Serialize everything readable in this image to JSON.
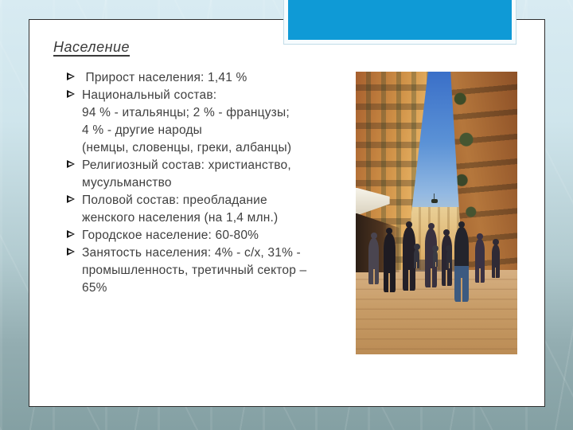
{
  "slide": {
    "title": "Население",
    "body": {
      "lines": [
        {
          "bullet": true,
          "text": " Прирост населения: 1,41 %"
        },
        {
          "bullet": true,
          "text": "Национальный состав:"
        },
        {
          "bullet": false,
          "text": "94 % - итальянцы; 2 % - французы;"
        },
        {
          "bullet": false,
          "text": "4 % - другие народы"
        },
        {
          "bullet": false,
          "text": "(немцы, словенцы, греки, албанцы)"
        },
        {
          "bullet": true,
          "text": "Религиозный состав: христианство,"
        },
        {
          "bullet": false,
          "text": "мусульманство"
        },
        {
          "bullet": true,
          "text": "Половой состав: преобладание"
        },
        {
          "bullet": false,
          "text": "женского населения (на 1,4 млн.)"
        },
        {
          "bullet": true,
          "text": "Городское население: 60-80%"
        },
        {
          "bullet": true,
          "text": "Занятость населения: 4% - с/х, 31% -"
        },
        {
          "bullet": false,
          "text": "промышленность, третичный сектор –"
        },
        {
          "bullet": false,
          "text": "65%"
        }
      ]
    }
  },
  "icons": {
    "bullet_arrow": "➢"
  },
  "colors": {
    "accent_blue": "#0f9ad6",
    "text": "#3f3f3f",
    "slide_background": "#ffffff",
    "background_top": "#d8ebf2",
    "background_bottom": "#84a0a3",
    "slide_border": "#2e2e2e"
  }
}
